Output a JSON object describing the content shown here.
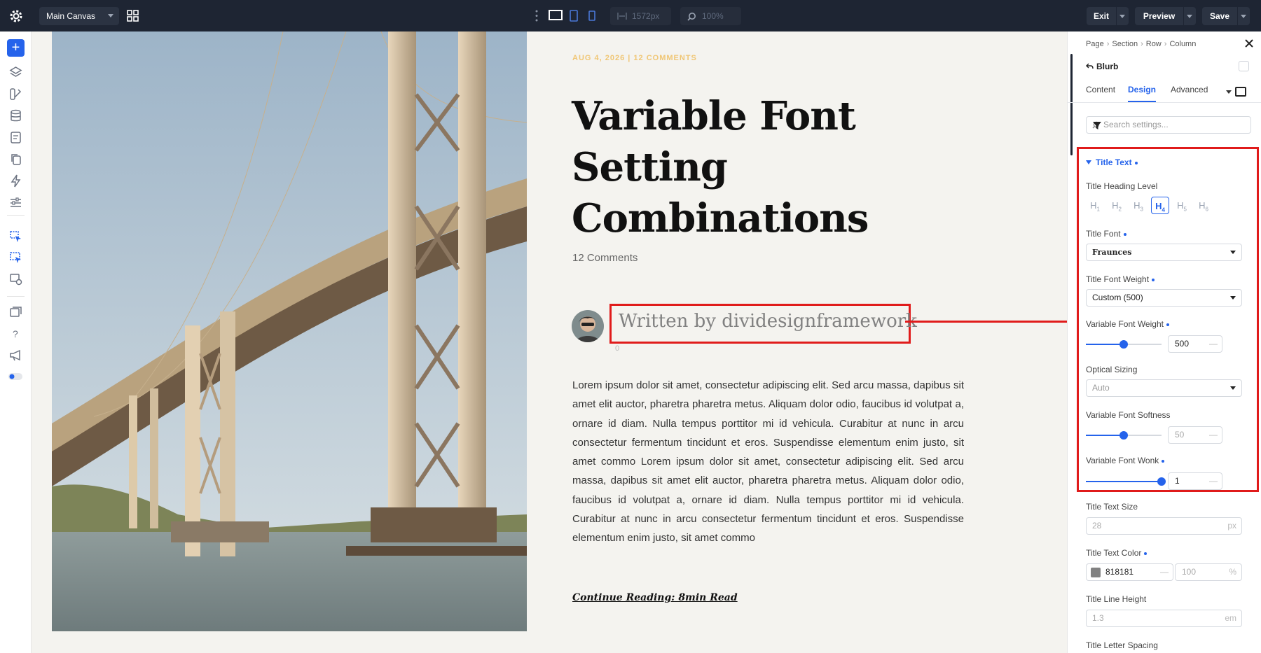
{
  "topbar": {
    "canvas_name": "Main Canvas",
    "width_value": "1572px",
    "zoom_value": "100%",
    "exit_label": "Exit",
    "preview_label": "Preview",
    "save_label": "Save",
    "colors": {
      "bg": "#1e2533",
      "accent": "#2563eb"
    }
  },
  "left_rail": {
    "icons": [
      "add-icon",
      "layers-icon",
      "paint-icon",
      "database-icon",
      "page-icon",
      "copy-icon",
      "bolt-icon",
      "sliders-icon",
      "cursor-icon",
      "cursor-multi-icon",
      "preset-icon",
      "window-icon",
      "help-icon",
      "megaphone-icon",
      "toggle-icon"
    ]
  },
  "article": {
    "meta_date": "AUG 4, 2026",
    "meta_sep": " | ",
    "meta_comments": "12 COMMENTS",
    "title": "Variable Font Setting Combinations",
    "comments": "12 Comments",
    "author": "Written by dividesignframework",
    "author_sub": "0",
    "body": "Lorem ipsum dolor sit amet, consectetur adipiscing elit. Sed arcu massa, dapibus sit amet elit auctor, pharetra pharetra metus. Aliquam dolor odio, faucibus id volutpat a, ornare id diam. Nulla tempus porttitor mi id vehicula. Curabitur at nunc in arcu consectetur fermentum tincidunt et eros. Suspendisse elementum enim justo, sit amet commo Lorem ipsum dolor sit amet, consectetur adipiscing elit. Sed arcu massa, dapibus sit amet elit auctor, pharetra pharetra metus. Aliquam dolor odio, faucibus id volutpat a, ornare id diam. Nulla tempus porttitor mi id vehicula. Curabitur at nunc in arcu consectetur fermentum tincidunt et eros. Suspendisse elementum enim justo, sit amet commo",
    "continue": "Continue Reading: 8min Read"
  },
  "panel": {
    "breadcrumb": [
      "Page",
      "Section",
      "Row",
      "Column"
    ],
    "module_name": "Blurb",
    "tabs": [
      {
        "label": "Content",
        "active": false
      },
      {
        "label": "Design",
        "active": true
      },
      {
        "label": "Advanced",
        "active": false
      }
    ],
    "search_placeholder": "Search settings...",
    "section_title": "Title Text",
    "heading_level": {
      "label": "Title Heading Level",
      "options": [
        "H",
        "H",
        "H",
        "H",
        "H",
        "H"
      ],
      "subs": [
        "1",
        "2",
        "3",
        "4",
        "5",
        "6"
      ],
      "selected": "H4"
    },
    "title_font": {
      "label": "Title Font",
      "value": "Fraunces"
    },
    "title_font_weight": {
      "label": "Title Font Weight",
      "value": "Custom (500)"
    },
    "variable_font_weight": {
      "label": "Variable Font Weight",
      "value": "500",
      "dash": "—",
      "fraction": 0.5
    },
    "optical_sizing": {
      "label": "Optical Sizing",
      "value": "Auto"
    },
    "variable_font_softness": {
      "label": "Variable Font Softness",
      "value": "50",
      "dash": "—",
      "fraction": 0.5
    },
    "variable_font_wonk": {
      "label": "Variable Font Wonk",
      "value": "1",
      "dash": "—",
      "fraction": 1.0
    },
    "title_text_size": {
      "label": "Title Text Size",
      "value": "28",
      "unit": "px"
    },
    "title_text_color": {
      "label": "Title Text Color",
      "value": "818181",
      "dash": "—",
      "opacity": "100",
      "unit": "%"
    },
    "title_line_height": {
      "label": "Title Line Height",
      "value": "1.3",
      "unit": "em"
    },
    "title_letter_spacing": {
      "label": "Title Letter Spacing"
    }
  }
}
